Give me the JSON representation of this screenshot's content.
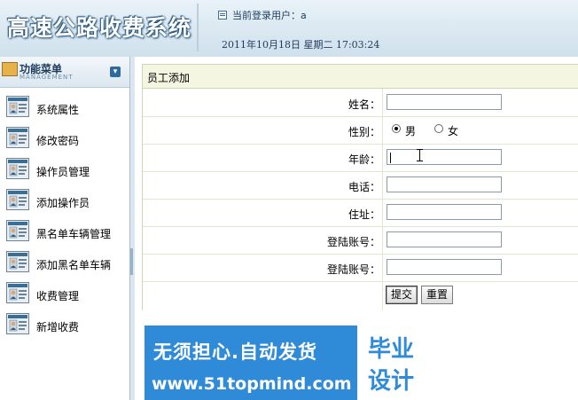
{
  "header": {
    "system_title": "高速公路收费系统",
    "current_user_label": "当前登录用户：a",
    "datetime": "2011年10月18日  星期二  17:03:24"
  },
  "sidebar": {
    "title": "功能菜单",
    "subtitle": "MANAGEMENT",
    "collapse_icon": "chevron-down-icon",
    "items": [
      {
        "label": "系统属性",
        "icon": "user-card-icon"
      },
      {
        "label": "修改密码",
        "icon": "user-card-icon"
      },
      {
        "label": "操作员管理",
        "icon": "user-card-icon"
      },
      {
        "label": "添加操作员",
        "icon": "user-card-icon"
      },
      {
        "label": "黑名单车辆管理",
        "icon": "user-card-icon"
      },
      {
        "label": "添加黑名单车辆",
        "icon": "user-card-icon"
      },
      {
        "label": "收费管理",
        "icon": "user-card-icon"
      },
      {
        "label": "新增收费",
        "icon": "user-card-icon"
      }
    ]
  },
  "form": {
    "title": "员工添加",
    "fields": {
      "name_label": "姓名：",
      "name_value": "",
      "gender_label": "性别：",
      "gender_options": [
        "男",
        "女"
      ],
      "gender_selected": "男",
      "age_label": "年龄：",
      "age_value": "",
      "phone_label": "电话：",
      "phone_value": "",
      "address_label": "住址：",
      "address_value": "",
      "login_account_label": "登陆账号：",
      "login_account_value": "",
      "login_account2_label": "登陆账号：",
      "login_account2_value": ""
    },
    "submit_label": "提交",
    "reset_label": "重置"
  },
  "banner": {
    "line1": "无须担心.自动发货",
    "line2": "www.51topmind.com",
    "right_line1": "毕业",
    "right_line2": "设计"
  },
  "colors": {
    "header_bg": "#cfe0ec",
    "panel_title_bg": "#f5f6e1",
    "banner_blue": "#2f8ad8"
  }
}
